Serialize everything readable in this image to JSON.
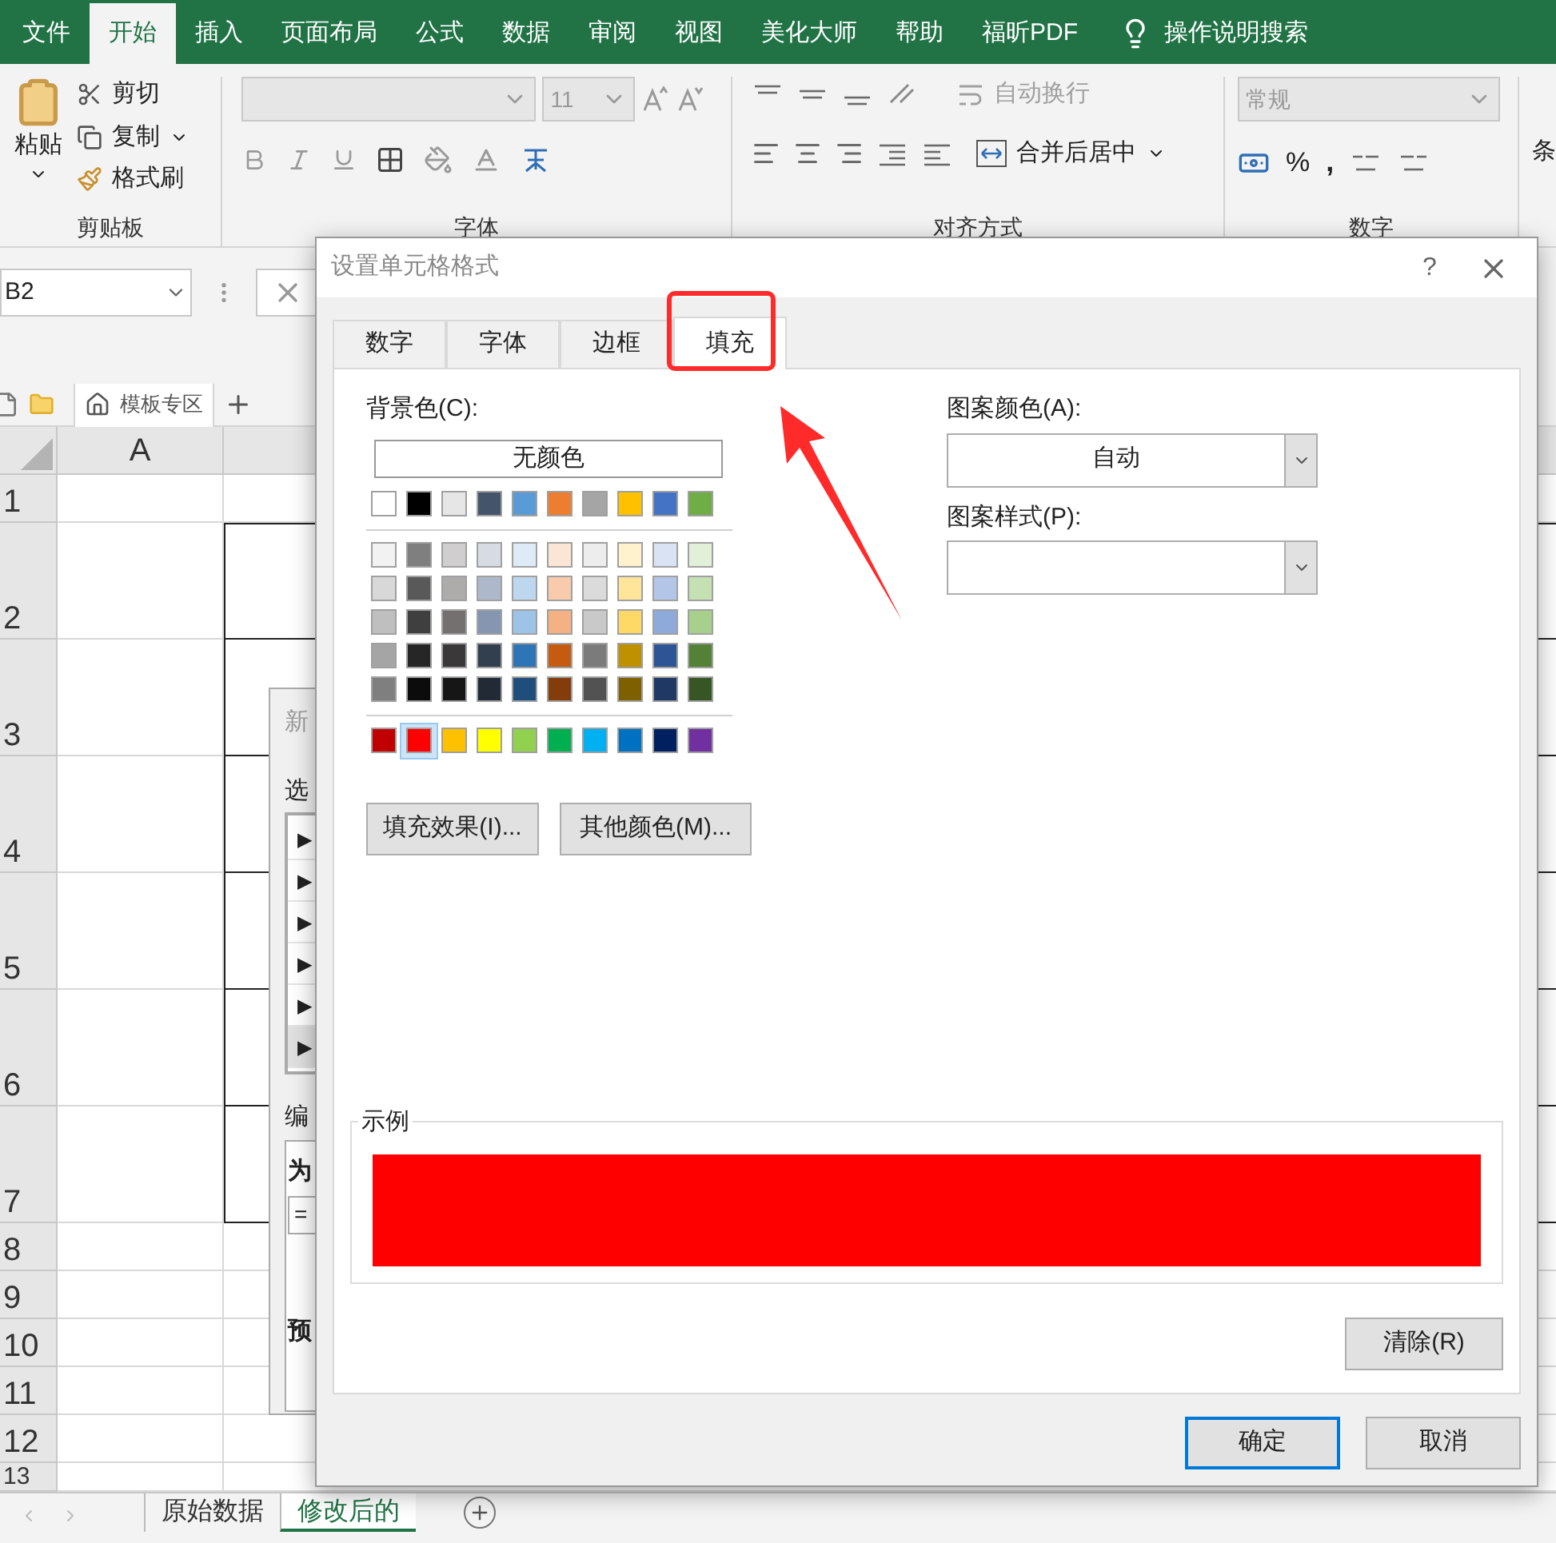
{
  "ribbon_tabs": [
    {
      "label": "文件",
      "selected": false
    },
    {
      "label": "开始",
      "selected": true
    },
    {
      "label": "插入",
      "selected": false
    },
    {
      "label": "页面布局",
      "selected": false
    },
    {
      "label": "公式",
      "selected": false
    },
    {
      "label": "数据",
      "selected": false
    },
    {
      "label": "审阅",
      "selected": false
    },
    {
      "label": "视图",
      "selected": false
    },
    {
      "label": "美化大师",
      "selected": false
    },
    {
      "label": "帮助",
      "selected": false
    },
    {
      "label": "福昕PDF",
      "selected": false
    }
  ],
  "search_label": "操作说明搜索",
  "clipboard": {
    "paste": "粘贴",
    "cut": "剪切",
    "copy": "复制",
    "format_painter": "格式刷",
    "group": "剪贴板"
  },
  "font": {
    "size": "11",
    "group": "字体"
  },
  "alignment": {
    "wrap": "自动换行",
    "wrap_disabled": true,
    "merge": "合并后居中",
    "group": "对齐方式"
  },
  "number": {
    "format": "常规",
    "format_disabled": true,
    "percent": "%",
    "comma": ",",
    "group": "数字"
  },
  "cut_off_group": "条",
  "name_box": "B2",
  "template_tab": "模板专区",
  "grid": {
    "column_a": "A",
    "rows": [
      "1",
      "2",
      "3",
      "4",
      "5",
      "6",
      "7",
      "8",
      "9",
      "10",
      "11",
      "12",
      "13"
    ]
  },
  "background_dialog": {
    "title": "新",
    "label_1": "选",
    "items": [
      {
        "marker": "▶",
        "selected": false
      },
      {
        "marker": "▶",
        "selected": false
      },
      {
        "marker": "▶",
        "selected": false
      },
      {
        "marker": "▶",
        "selected": false
      },
      {
        "marker": "▶",
        "selected": false
      },
      {
        "marker": "▶",
        "selected": true
      }
    ],
    "label_2": "编",
    "bold_label": "为",
    "field": "=",
    "label_3": "预"
  },
  "sheet_tabs": [
    {
      "label": "原始数据",
      "selected": false
    },
    {
      "label": "修改后的",
      "selected": true
    }
  ],
  "dialog": {
    "title": "设置单元格格式",
    "help": "?",
    "tabs": [
      {
        "label": "数字",
        "selected": false
      },
      {
        "label": "字体",
        "selected": false
      },
      {
        "label": "边框",
        "selected": false
      },
      {
        "label": "填充",
        "selected": true
      }
    ],
    "background_label": "背景色(C):",
    "no_color": "无颜色",
    "theme_colors": [
      {
        "color": "#ffffff",
        "selected": false
      },
      {
        "color": "#000000",
        "selected": false
      },
      {
        "color": "#e7e6e6",
        "selected": false
      },
      {
        "color": "#44546a",
        "selected": false
      },
      {
        "color": "#5b9bd5",
        "selected": false
      },
      {
        "color": "#ed7d31",
        "selected": false
      },
      {
        "color": "#a5a5a5",
        "selected": false
      },
      {
        "color": "#ffc000",
        "selected": false
      },
      {
        "color": "#4472c4",
        "selected": false
      },
      {
        "color": "#70ad47",
        "selected": false
      }
    ],
    "tints": [
      [
        {
          "color": "#f2f2f2",
          "selected": false
        },
        {
          "color": "#7f7f7f",
          "selected": false
        },
        {
          "color": "#d0cece",
          "selected": false
        },
        {
          "color": "#d6dce4",
          "selected": false
        },
        {
          "color": "#deebf6",
          "selected": false
        },
        {
          "color": "#fbe5d5",
          "selected": false
        },
        {
          "color": "#ededed",
          "selected": false
        },
        {
          "color": "#fff2cc",
          "selected": false
        },
        {
          "color": "#dae3f3",
          "selected": false
        },
        {
          "color": "#e2efd9",
          "selected": false
        }
      ],
      [
        {
          "color": "#d8d8d8",
          "selected": false
        },
        {
          "color": "#595959",
          "selected": false
        },
        {
          "color": "#aeabab",
          "selected": false
        },
        {
          "color": "#adb9ca",
          "selected": false
        },
        {
          "color": "#bdd7ee",
          "selected": false
        },
        {
          "color": "#f7cbac",
          "selected": false
        },
        {
          "color": "#dbdbdb",
          "selected": false
        },
        {
          "color": "#fee599",
          "selected": false
        },
        {
          "color": "#b4c6e7",
          "selected": false
        },
        {
          "color": "#c5e0b3",
          "selected": false
        }
      ],
      [
        {
          "color": "#bfbfbf",
          "selected": false
        },
        {
          "color": "#3f3f3f",
          "selected": false
        },
        {
          "color": "#757070",
          "selected": false
        },
        {
          "color": "#8496b0",
          "selected": false
        },
        {
          "color": "#9dc3e6",
          "selected": false
        },
        {
          "color": "#f4b183",
          "selected": false
        },
        {
          "color": "#c9c9c9",
          "selected": false
        },
        {
          "color": "#ffd965",
          "selected": false
        },
        {
          "color": "#8eaadb",
          "selected": false
        },
        {
          "color": "#a8d08d",
          "selected": false
        }
      ],
      [
        {
          "color": "#a5a5a5",
          "selected": false
        },
        {
          "color": "#262626",
          "selected": false
        },
        {
          "color": "#3a3838",
          "selected": false
        },
        {
          "color": "#323f4f",
          "selected": false
        },
        {
          "color": "#2e75b5",
          "selected": false
        },
        {
          "color": "#c55a11",
          "selected": false
        },
        {
          "color": "#7b7b7b",
          "selected": false
        },
        {
          "color": "#bf9000",
          "selected": false
        },
        {
          "color": "#2f5496",
          "selected": false
        },
        {
          "color": "#538135",
          "selected": false
        }
      ],
      [
        {
          "color": "#7f7f7f",
          "selected": false
        },
        {
          "color": "#0c0c0c",
          "selected": false
        },
        {
          "color": "#171616",
          "selected": false
        },
        {
          "color": "#222a35",
          "selected": false
        },
        {
          "color": "#1e4e79",
          "selected": false
        },
        {
          "color": "#843c0b",
          "selected": false
        },
        {
          "color": "#525252",
          "selected": false
        },
        {
          "color": "#7f6000",
          "selected": false
        },
        {
          "color": "#1f3864",
          "selected": false
        },
        {
          "color": "#375623",
          "selected": false
        }
      ]
    ],
    "standard_colors": [
      {
        "color": "#c00000",
        "selected": false
      },
      {
        "color": "#ff0000",
        "selected": true
      },
      {
        "color": "#ffc000",
        "selected": false
      },
      {
        "color": "#ffff00",
        "selected": false
      },
      {
        "color": "#92d050",
        "selected": false
      },
      {
        "color": "#00b050",
        "selected": false
      },
      {
        "color": "#00b0f0",
        "selected": false
      },
      {
        "color": "#0070c0",
        "selected": false
      },
      {
        "color": "#002060",
        "selected": false
      },
      {
        "color": "#7030a0",
        "selected": false
      }
    ],
    "fill_effects": "填充效果(I)...",
    "more_colors": "其他颜色(M)...",
    "pattern_color_label": "图案颜色(A):",
    "pattern_color": "自动",
    "pattern_style_label": "图案样式(P):",
    "sample_label": "示例",
    "sample": {
      "color": "#ff0000"
    },
    "clear": "清除(R)",
    "ok": "确定",
    "cancel": "取消"
  }
}
